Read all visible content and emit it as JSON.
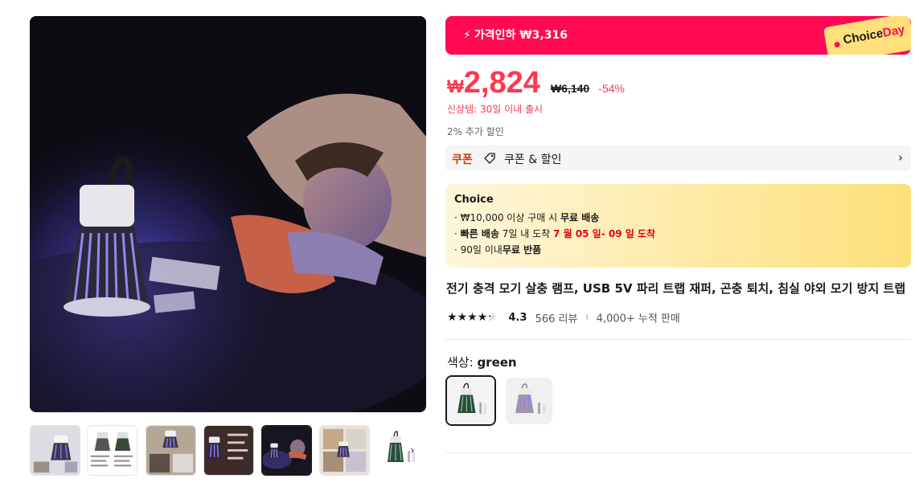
{
  "promo": {
    "bolt": "⚡",
    "label": "가격인하 ₩3,316",
    "badge_choice": "Choice",
    "badge_day": "Day"
  },
  "price": {
    "currency": "₩",
    "current": "2,824",
    "original": "₩6,140",
    "discount": "-54%"
  },
  "new_item_note": "신상템: 30일 이내 출시",
  "extra_discount": "2% 추가 할인",
  "coupon": {
    "tag": "쿠폰",
    "label": "쿠폰 & 할인",
    "arrow": "›"
  },
  "choice": {
    "title": "Choice",
    "line1_prefix": "· ₩10,000 이상 구매 시 ",
    "line1_bold": "무료 배송",
    "line2_prefix": "· ",
    "line2_bold": "빠른 배송",
    "line2_mid": " 7일 내 도착 ",
    "line2_red": "7 월 05 일- 09 일 도착",
    "line3_prefix": "· 90일 이내",
    "line3_bold": "무료 반품"
  },
  "product": {
    "title": "전기 충격 모기 살충 램프, USB 5V 파리 트랩 재퍼, 곤충 퇴치, 침실 야외 모기 방지 트랩"
  },
  "rating": {
    "stars": 4.3,
    "value": "4.3",
    "reviews": "566 리뷰",
    "separator": "I",
    "sold": "4,000+ 누적 판매"
  },
  "color": {
    "label": "색상: ",
    "value": "green",
    "options": [
      "green",
      "white"
    ]
  },
  "gallery": {
    "thumbnail_count": 7,
    "selected_index": 4,
    "next_arrow": "›"
  }
}
